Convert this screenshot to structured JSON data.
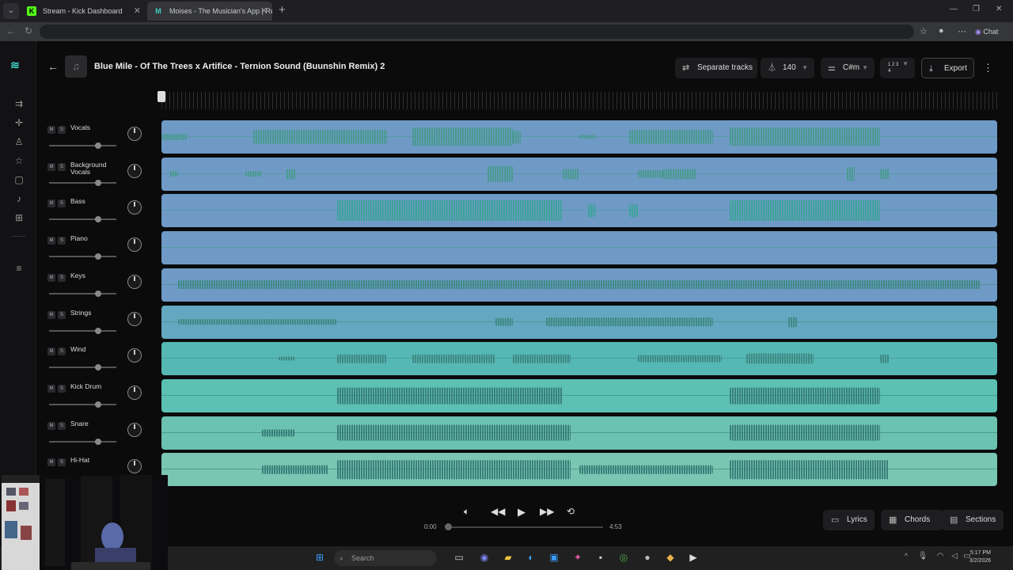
{
  "browser": {
    "tabs": [
      {
        "title": "Stream - Kick Dashboard",
        "fav": "K",
        "fav_color": "#53fc18"
      },
      {
        "title": "Moises - The Musician's App | Ren",
        "fav": "M",
        "fav_color": "#3fd0bf"
      }
    ],
    "chat_label": "Chat"
  },
  "header": {
    "song_title": "Blue Mile - Of The Trees x Artifice - Ternion Sound (Buunshin Remix) 2",
    "separate_tracks_label": "Separate tracks",
    "bpm": "140",
    "key": "C#m",
    "time_sig": "1 2 3 4",
    "export_label": "Export"
  },
  "tracks": [
    {
      "name": "Vocals",
      "color": "#6f9ac6",
      "wave_color": "#4a9a90",
      "segments": [
        [
          0,
          0.03,
          0.3
        ],
        [
          0.11,
          0.16,
          0.7
        ],
        [
          0.3,
          0.12,
          0.9
        ],
        [
          0.42,
          0.01,
          0.6
        ],
        [
          0.5,
          0.02,
          0.2
        ],
        [
          0.56,
          0.1,
          0.7
        ],
        [
          0.68,
          0.18,
          0.9
        ]
      ]
    },
    {
      "name": "Background Vocals",
      "color": "#6f9ac6",
      "wave_color": "#4a9a90",
      "segments": [
        [
          0.01,
          0.01,
          0.3
        ],
        [
          0.1,
          0.02,
          0.3
        ],
        [
          0.15,
          0.01,
          0.5
        ],
        [
          0.39,
          0.03,
          0.8
        ],
        [
          0.48,
          0.02,
          0.5
        ],
        [
          0.57,
          0.03,
          0.4
        ],
        [
          0.6,
          0.04,
          0.5
        ],
        [
          0.82,
          0.01,
          0.7
        ],
        [
          0.86,
          0.01,
          0.5
        ]
      ]
    },
    {
      "name": "Bass",
      "color": "#6f9ac6",
      "wave_color": "#3ea39a",
      "segments": [
        [
          0.21,
          0.27,
          1.0
        ],
        [
          0.51,
          0.01,
          0.6
        ],
        [
          0.56,
          0.01,
          0.6
        ],
        [
          0.68,
          0.18,
          1.0
        ]
      ]
    },
    {
      "name": "Piano",
      "color": "#6f9ac6",
      "wave_color": "#4a9a90",
      "segments": []
    },
    {
      "name": "Keys",
      "color": "#6f9ac6",
      "wave_color": "#3f8a85",
      "segments": [
        [
          0.02,
          0.96,
          0.45
        ]
      ]
    },
    {
      "name": "Strings",
      "color": "#63a7c0",
      "wave_color": "#3f8a85",
      "segments": [
        [
          0.02,
          0.19,
          0.3
        ],
        [
          0.4,
          0.02,
          0.4
        ],
        [
          0.46,
          0.2,
          0.45
        ],
        [
          0.75,
          0.01,
          0.5
        ]
      ]
    },
    {
      "name": "Wind",
      "color": "#56b8b4",
      "wave_color": "#3f8a85",
      "segments": [
        [
          0.14,
          0.02,
          0.2
        ],
        [
          0.21,
          0.06,
          0.4
        ],
        [
          0.3,
          0.1,
          0.4
        ],
        [
          0.42,
          0.07,
          0.4
        ],
        [
          0.57,
          0.1,
          0.35
        ],
        [
          0.7,
          0.08,
          0.5
        ],
        [
          0.86,
          0.01,
          0.4
        ]
      ]
    },
    {
      "name": "Kick Drum",
      "color": "#5cc1b3",
      "wave_color": "#3a7f7a",
      "segments": [
        [
          0.21,
          0.27,
          0.8
        ],
        [
          0.68,
          0.18,
          0.8
        ]
      ]
    },
    {
      "name": "Snare",
      "color": "#6cc2b1",
      "wave_color": "#3a7f7a",
      "segments": [
        [
          0.12,
          0.04,
          0.35
        ],
        [
          0.21,
          0.28,
          0.8
        ],
        [
          0.68,
          0.18,
          0.8
        ]
      ]
    },
    {
      "name": "Hi-Hat",
      "color": "#79c6b3",
      "wave_color": "#3a7f7a",
      "segments": [
        [
          0.12,
          0.08,
          0.4
        ],
        [
          0.21,
          0.28,
          0.9
        ],
        [
          0.5,
          0.16,
          0.4
        ],
        [
          0.68,
          0.19,
          0.9
        ]
      ]
    }
  ],
  "transport": {
    "current_time": "0:00",
    "total_time": "4:53",
    "lyrics_label": "Lyrics",
    "chords_label": "Chords",
    "sections_label": "Sections"
  },
  "taskbar": {
    "search_placeholder": "Search",
    "time": "5:17 PM",
    "date": "3/2/2026"
  }
}
